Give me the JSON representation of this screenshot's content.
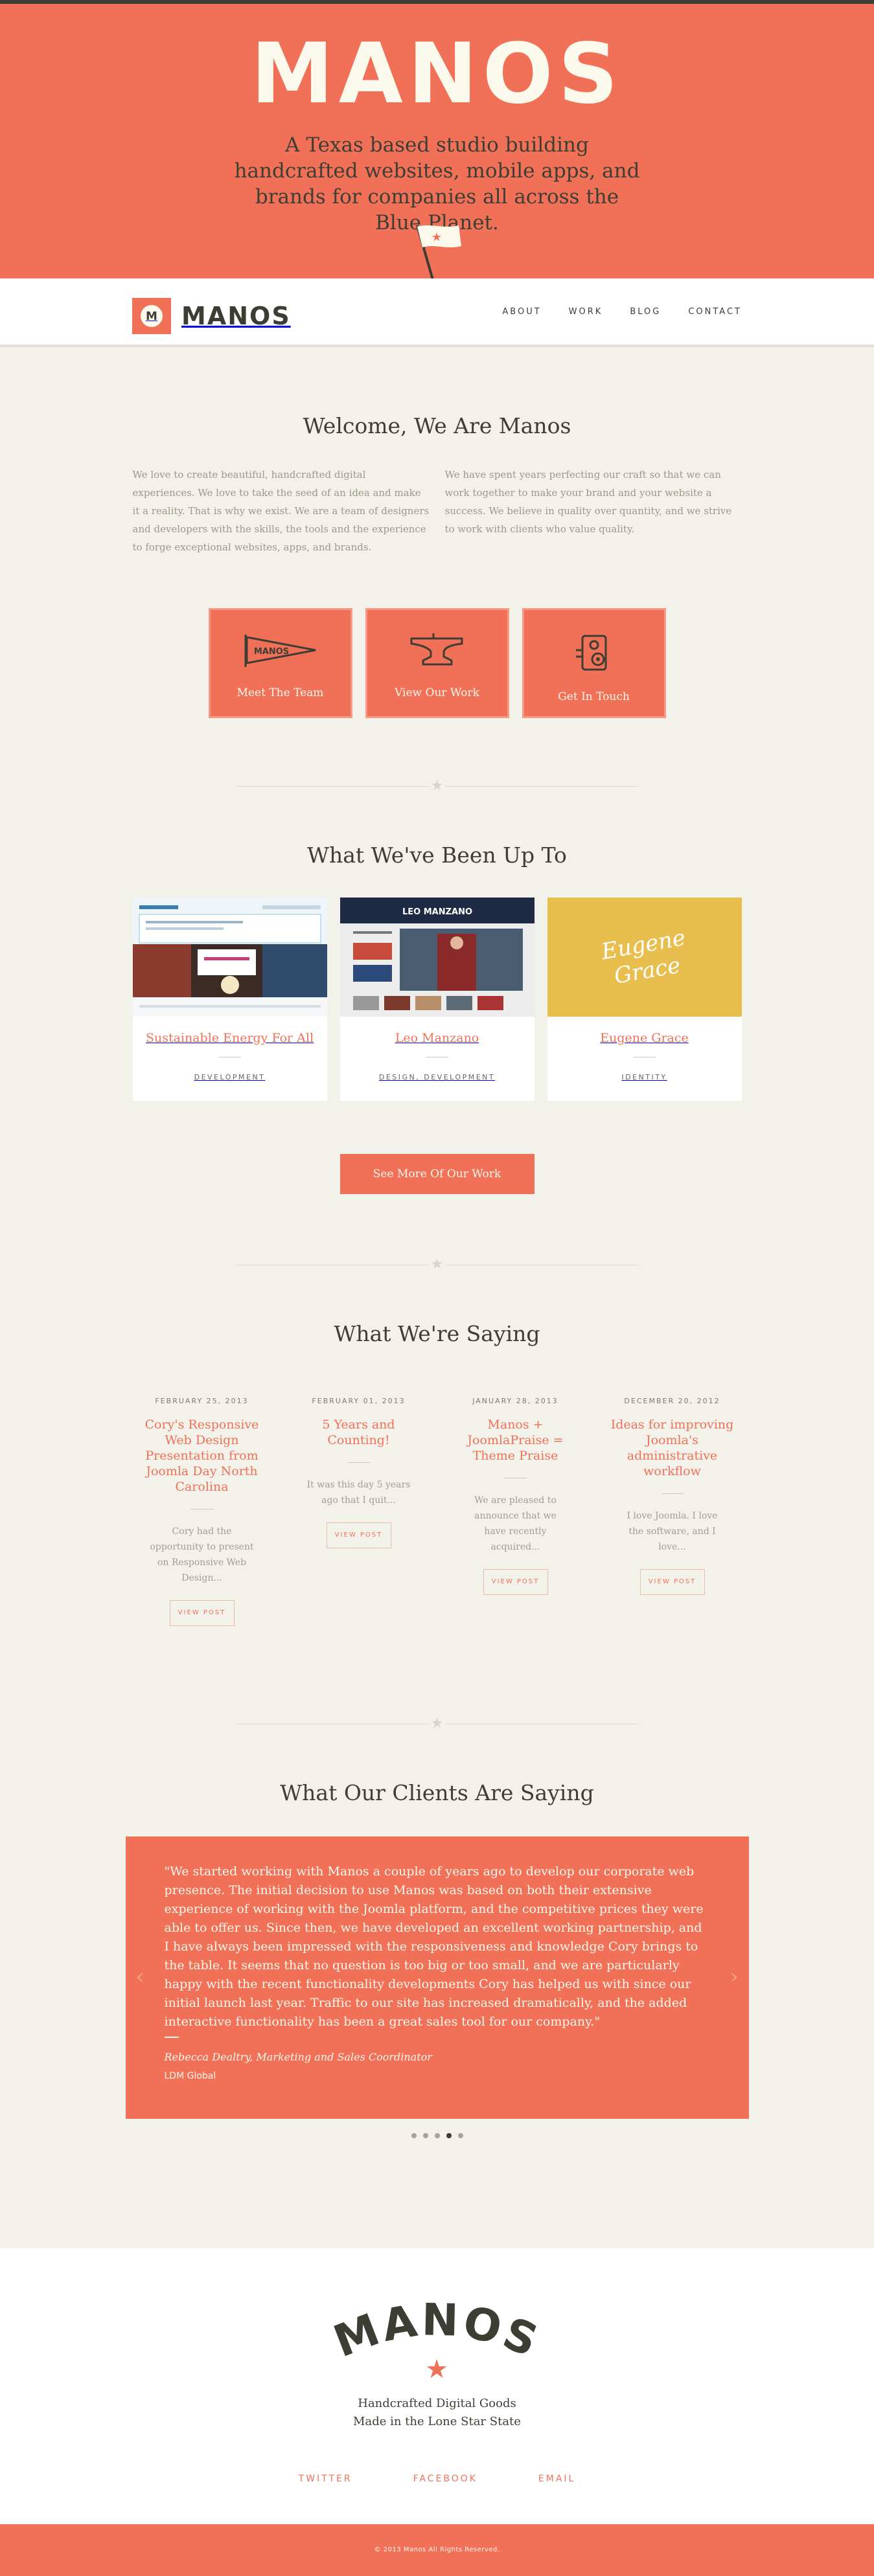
{
  "colors": {
    "accent": "#f07157",
    "dark": "#3d3d33",
    "cream": "#fbf8ec",
    "background": "#f2f1ea",
    "muted": "#9a9a8c",
    "gold": "#e8bf4f"
  },
  "hero": {
    "logo": "MANOS",
    "tagline": "A Texas based studio building handcrafted websites, mobile apps, and brands for companies all across the Blue Planet.",
    "flag_icon": "texas-flag-icon"
  },
  "nav": {
    "brand_mark": "M",
    "brand_name": "MANOS",
    "links": [
      {
        "label": "ABOUT"
      },
      {
        "label": "WORK"
      },
      {
        "label": "BLOG"
      },
      {
        "label": "CONTACT"
      }
    ]
  },
  "welcome": {
    "title": "Welcome, We Are Manos",
    "paragraphs": [
      "We love to create beautiful, handcrafted digital experiences. We love to take the seed of an idea and make it a reality. That is why we exist. We are a team of designers and developers with the skills, the tools and the experience to forge exceptional websites, apps, and brands.",
      "We have spent years perfecting our craft so that we can work together to make your brand and your website a success. We believe in quality over quantity, and we strive to work with clients who value quality."
    ],
    "ctas": [
      {
        "label": "Meet The Team",
        "icon": "pennant-icon"
      },
      {
        "label": "View Our Work",
        "icon": "anvil-icon"
      },
      {
        "label": "Get In Touch",
        "icon": "camera-phone-icon"
      }
    ]
  },
  "work": {
    "title": "What We've Been Up To",
    "items": [
      {
        "title": "Sustainable Energy For All",
        "tags": "DEVELOPMENT"
      },
      {
        "title": "Leo Manzano",
        "tags": "DESIGN, DEVELOPMENT",
        "thumb_label": "LEO MANZANO"
      },
      {
        "title": "Eugene Grace",
        "tags": "IDENTITY",
        "thumb_label_1": "Eugene",
        "thumb_label_2": "Grace"
      }
    ],
    "more_label": "See More Of Our Work"
  },
  "blog": {
    "title": "What We're Saying",
    "posts": [
      {
        "date": "FEBRUARY 25, 2013",
        "title": "Cory's Responsive Web Design Presentation from Joomla Day North Carolina",
        "excerpt": "Cory had the opportunity to present on Responsive Web Design...",
        "button": "VIEW POST"
      },
      {
        "date": "FEBRUARY 01, 2013",
        "title": "5 Years and Counting!",
        "excerpt": "It was this day 5 years ago that I quit...",
        "button": "VIEW POST"
      },
      {
        "date": "JANUARY 28, 2013",
        "title": "Manos + JoomlaPraise = Theme Praise",
        "excerpt": "We are pleased to announce that we have recently acquired...",
        "button": "VIEW POST"
      },
      {
        "date": "DECEMBER 20, 2012",
        "title": "Ideas for improving Joomla's administrative workflow",
        "excerpt": "I love Joomla. I love the software, and I love...",
        "button": "VIEW POST"
      }
    ]
  },
  "testimonials": {
    "title": "What Our Clients Are Saying",
    "quote": "\"We started working with Manos a couple of years ago to develop our corporate web presence. The initial decision to use Manos was based on both their extensive experience of working with the Joomla platform, and the competitive prices they were able to offer us. Since then, we have developed an excellent working partnership, and I have always been impressed with the responsiveness and knowledge Cory brings to the table. It seems that no question is too big or too small, and we are particularly happy with the recent functionality developments Cory has helped us with since our initial launch last year. Traffic to our site has increased dramatically, and the added interactive functionality has been a great sales tool for our company.\"",
    "name": "Rebecca Dealtry, Marketing and Sales Coordinator",
    "company": "LDM Global",
    "prev_icon": "arrow-left-icon",
    "next_icon": "arrow-right-icon",
    "dots": 5,
    "active_dot": 4
  },
  "footer": {
    "logo": "MANOS",
    "tagline_1": "Handcrafted Digital Goods",
    "tagline_2": "Made in the Lone Star State",
    "links": [
      {
        "label": "TWITTER"
      },
      {
        "label": "FACEBOOK"
      },
      {
        "label": "EMAIL"
      }
    ],
    "copyright": "© 2013 Manos All Rights Reserved."
  }
}
